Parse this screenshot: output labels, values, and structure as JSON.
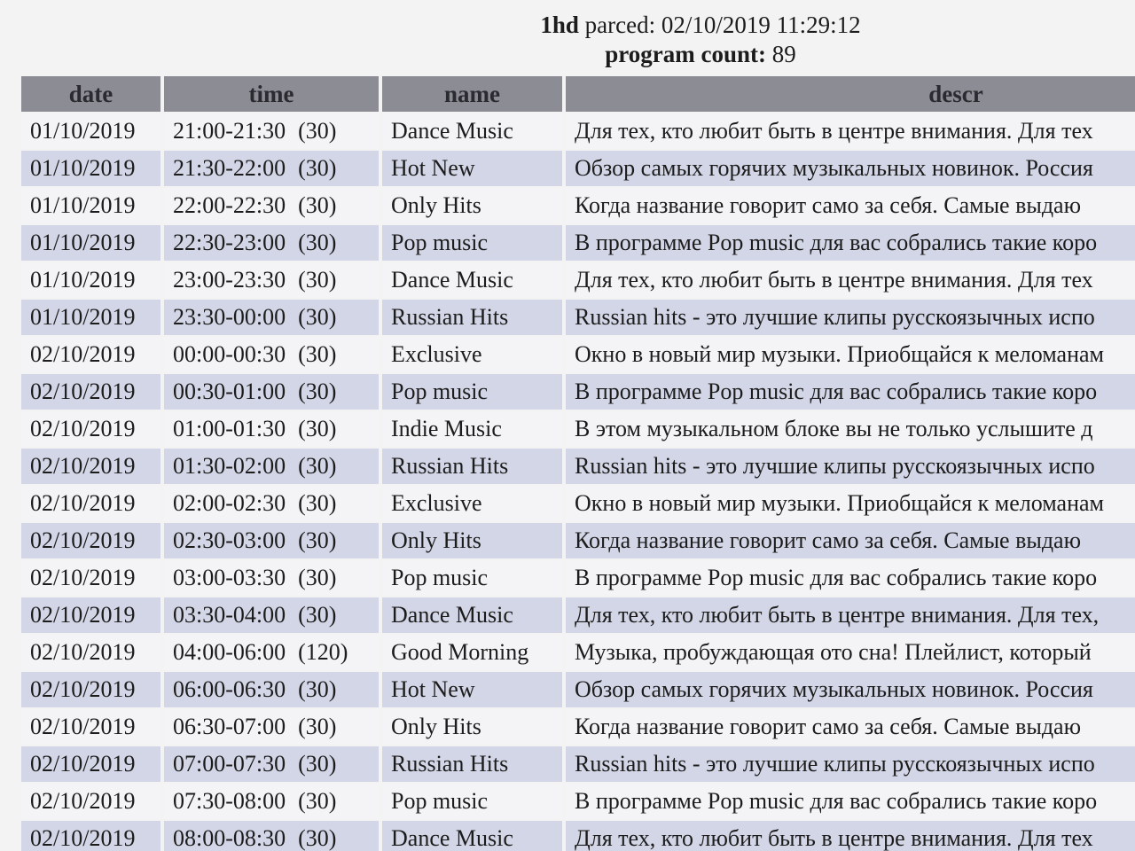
{
  "header": {
    "parsed_label": "1hd",
    "parsed_word": "parced:",
    "parsed_value": "02/10/2019 11:29:12",
    "count_label": "program count:",
    "count_value": "89"
  },
  "table": {
    "columns": [
      "date",
      "time",
      "name",
      "descr"
    ],
    "rows": [
      {
        "date": "01/10/2019",
        "time": "21:00-21:30",
        "dur": "(30)",
        "name": "Dance Music",
        "descr": "Для тех, кто любит быть в центре внимания. Для тех"
      },
      {
        "date": "01/10/2019",
        "time": "21:30-22:00",
        "dur": "(30)",
        "name": "Hot New",
        "descr": "Обзор самых горячих музыкальных новинок. Россия"
      },
      {
        "date": "01/10/2019",
        "time": "22:00-22:30",
        "dur": "(30)",
        "name": "Only Hits",
        "descr": "Когда название говорит само за себя. Самые выдаю"
      },
      {
        "date": "01/10/2019",
        "time": "22:30-23:00",
        "dur": "(30)",
        "name": "Pop music",
        "descr": "В программе Pop music для вас собрались такие коро"
      },
      {
        "date": "01/10/2019",
        "time": "23:00-23:30",
        "dur": "(30)",
        "name": "Dance Music",
        "descr": "Для тех, кто любит быть в центре внимания. Для тех"
      },
      {
        "date": "01/10/2019",
        "time": "23:30-00:00",
        "dur": "(30)",
        "name": "Russian Hits",
        "descr": "Russian hits - это лучшие клипы русскоязычных испо"
      },
      {
        "date": "02/10/2019",
        "time": "00:00-00:30",
        "dur": "(30)",
        "name": "Exclusive",
        "descr": "Окно в новый мир музыки. Приобщайся к меломанам"
      },
      {
        "date": "02/10/2019",
        "time": "00:30-01:00",
        "dur": "(30)",
        "name": "Pop music",
        "descr": "В программе Pop music для вас собрались такие коро"
      },
      {
        "date": "02/10/2019",
        "time": "01:00-01:30",
        "dur": "(30)",
        "name": "Indie Music",
        "descr": "В этом музыкальном блоке вы не только услышите д"
      },
      {
        "date": "02/10/2019",
        "time": "01:30-02:00",
        "dur": "(30)",
        "name": "Russian Hits",
        "descr": "Russian hits - это лучшие клипы русскоязычных испо"
      },
      {
        "date": "02/10/2019",
        "time": "02:00-02:30",
        "dur": "(30)",
        "name": "Exclusive",
        "descr": "Окно в новый мир музыки. Приобщайся к меломанам"
      },
      {
        "date": "02/10/2019",
        "time": "02:30-03:00",
        "dur": "(30)",
        "name": "Only Hits",
        "descr": "Когда название говорит само за себя. Самые выдаю"
      },
      {
        "date": "02/10/2019",
        "time": "03:00-03:30",
        "dur": "(30)",
        "name": "Pop music",
        "descr": "В программе Pop music для вас собрались такие коро"
      },
      {
        "date": "02/10/2019",
        "time": "03:30-04:00",
        "dur": "(30)",
        "name": "Dance Music",
        "descr": "Для тех, кто любит быть в центре внимания. Для тех,"
      },
      {
        "date": "02/10/2019",
        "time": "04:00-06:00",
        "dur": "(120)",
        "name": "Good Morning",
        "descr": "Музыка, пробуждающая ото сна! Плейлист, который"
      },
      {
        "date": "02/10/2019",
        "time": "06:00-06:30",
        "dur": "(30)",
        "name": "Hot New",
        "descr": "Обзор самых горячих музыкальных новинок. Россия"
      },
      {
        "date": "02/10/2019",
        "time": "06:30-07:00",
        "dur": "(30)",
        "name": "Only Hits",
        "descr": "Когда название говорит само за себя. Самые выдаю"
      },
      {
        "date": "02/10/2019",
        "time": "07:00-07:30",
        "dur": "(30)",
        "name": "Russian Hits",
        "descr": "Russian hits - это лучшие клипы русскоязычных испо"
      },
      {
        "date": "02/10/2019",
        "time": "07:30-08:00",
        "dur": "(30)",
        "name": "Pop music",
        "descr": "В программе Pop music для вас собрались такие коро"
      },
      {
        "date": "02/10/2019",
        "time": "08:00-08:30",
        "dur": "(30)",
        "name": "Dance Music",
        "descr": "Для тех, кто любит быть в центре внимания. Для тех"
      }
    ]
  },
  "colors": {
    "header_bg": "#8c8c94",
    "row_odd": "#f4f4f6",
    "row_even": "#d3d6e6"
  }
}
